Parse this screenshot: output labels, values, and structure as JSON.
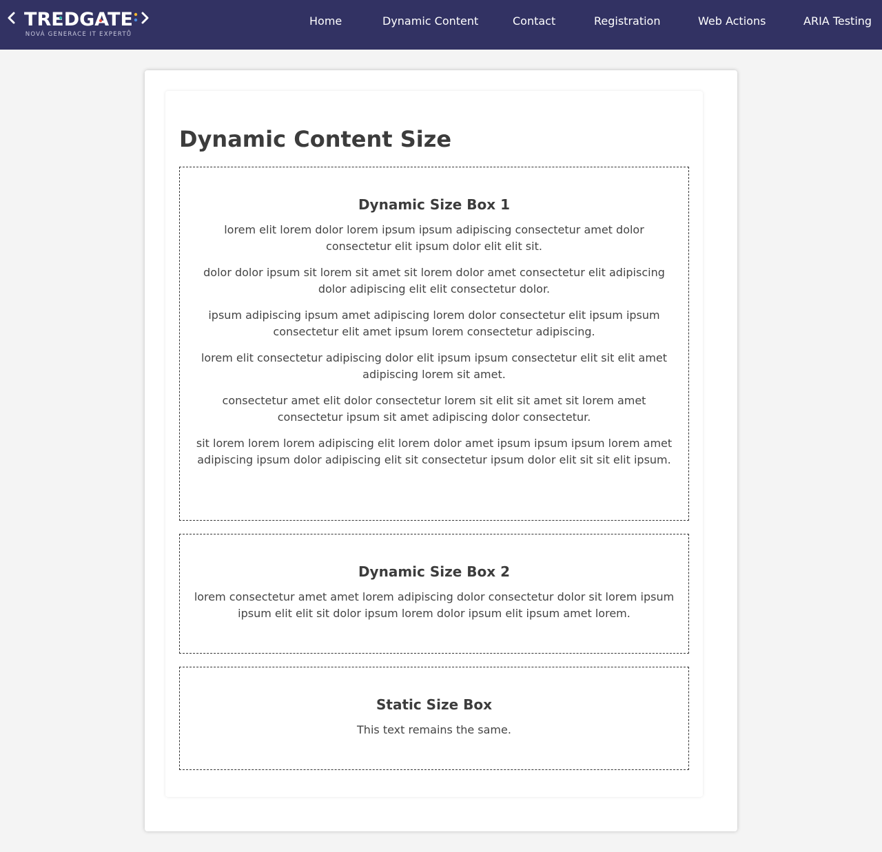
{
  "header": {
    "logo_text": "TREDGATE",
    "logo_tagline": "NOVÁ GENERACE IT EXPERTŮ",
    "nav": [
      {
        "label": "Home"
      },
      {
        "label": "Dynamic Content"
      },
      {
        "label": "Contact"
      },
      {
        "label": "Registration"
      },
      {
        "label": "Web Actions"
      },
      {
        "label": "ARIA Testing"
      }
    ]
  },
  "main": {
    "title": "Dynamic Content Size",
    "boxes": [
      {
        "title": "Dynamic Size Box 1",
        "paragraphs": [
          "lorem elit lorem dolor lorem ipsum ipsum adipiscing consectetur amet dolor consectetur elit ipsum dolor elit elit sit.",
          "dolor dolor ipsum sit lorem sit amet sit lorem dolor amet consectetur elit adipiscing dolor adipiscing elit elit consectetur dolor.",
          "ipsum adipiscing ipsum amet adipiscing lorem dolor consectetur elit ipsum ipsum consectetur elit amet ipsum lorem consectetur adipiscing.",
          "lorem elit consectetur adipiscing dolor elit ipsum ipsum consectetur elit sit elit amet adipiscing lorem sit amet.",
          "consectetur amet elit dolor consectetur lorem sit elit sit amet sit lorem amet consectetur ipsum sit amet adipiscing dolor consectetur.",
          "sit lorem lorem lorem adipiscing elit lorem dolor amet ipsum ipsum ipsum lorem amet adipiscing ipsum dolor adipiscing elit sit consectetur ipsum dolor elit sit sit elit ipsum."
        ]
      },
      {
        "title": "Dynamic Size Box 2",
        "paragraphs": [
          "lorem consectetur amet amet lorem adipiscing dolor consectetur dolor sit lorem ipsum ipsum elit elit sit dolor ipsum lorem dolor ipsum elit ipsum amet lorem."
        ]
      },
      {
        "title": "Static Size Box",
        "paragraphs": [
          "This text remains the same."
        ]
      }
    ]
  },
  "colors": {
    "header_bg": "#323263",
    "page_bg": "#f4f4f4",
    "logo_dot_teal": "#2bb3a6",
    "logo_dot_red": "#e0443c",
    "logo_dot_yellow": "#f2b632",
    "logo_dot_blue": "#4a8be0"
  }
}
